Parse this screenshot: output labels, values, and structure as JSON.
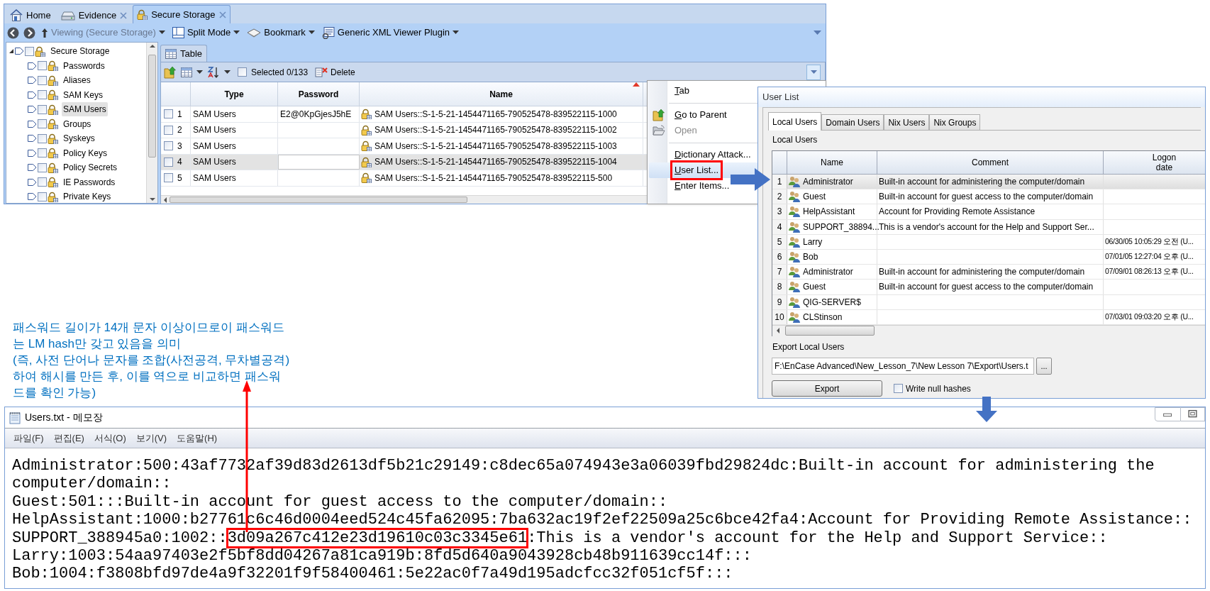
{
  "encase": {
    "tabs": [
      {
        "label": "Home",
        "closable": false,
        "selected": false
      },
      {
        "label": "Evidence",
        "closable": true,
        "selected": false
      },
      {
        "label": "Secure Storage",
        "closable": true,
        "selected": true
      }
    ],
    "toolbar": [
      {
        "label": "Viewing (Secure Storage)",
        "disabled": true
      },
      {
        "label": "Split Mode",
        "disabled": false
      },
      {
        "label": "Bookmark",
        "disabled": false
      },
      {
        "label": "Generic XML Viewer Plugin",
        "disabled": false
      }
    ],
    "tree": {
      "label": "Secure Storage",
      "expanded": true,
      "selected": false,
      "checked": false,
      "children": [
        {
          "label": "Passwords",
          "selected": false,
          "checked": false
        },
        {
          "label": "Aliases",
          "selected": false,
          "checked": false
        },
        {
          "label": "SAM Keys",
          "selected": false,
          "checked": false
        },
        {
          "label": "SAM Users",
          "selected": true,
          "checked": false
        },
        {
          "label": "Groups",
          "selected": false,
          "checked": false
        },
        {
          "label": "Syskeys",
          "selected": false,
          "checked": false
        },
        {
          "label": "Policy Keys",
          "selected": false,
          "checked": false
        },
        {
          "label": "Policy Secrets",
          "selected": false,
          "checked": false
        },
        {
          "label": "IE Passwords",
          "selected": false,
          "checked": false
        },
        {
          "label": "Private Keys",
          "selected": false,
          "checked": false
        }
      ]
    },
    "panel_tab": "Table",
    "table_toolbar": {
      "selection": {
        "label": "Selected 0/133",
        "checked": false
      },
      "delete": "Delete"
    },
    "table": {
      "columns": [
        {
          "label": "Type",
          "sorted": false
        },
        {
          "label": "Password",
          "sorted": false
        },
        {
          "label": "Name",
          "sorted": true
        }
      ],
      "rows": [
        {
          "number": "1",
          "checked": false,
          "selected": false,
          "type": "SAM Users",
          "password": "E2@0KpGjesJ5hE",
          "name": "SAM Users::S-1-5-21-1454471165-790525478-839522115-1000"
        },
        {
          "number": "2",
          "checked": false,
          "selected": false,
          "type": "SAM Users",
          "name": "SAM Users::S-1-5-21-1454471165-790525478-839522115-1002"
        },
        {
          "number": "3",
          "checked": false,
          "selected": false,
          "type": "SAM Users",
          "name": "SAM Users::S-1-5-21-1454471165-790525478-839522115-1003"
        },
        {
          "number": "4",
          "checked": false,
          "selected": true,
          "type": "SAM Users",
          "name": "SAM Users::S-1-5-21-1454471165-790525478-839522115-1004"
        },
        {
          "number": "5",
          "checked": false,
          "selected": false,
          "type": "SAM Users",
          "name": "SAM Users::S-1-5-21-1454471165-790525478-839522115-500"
        }
      ]
    }
  },
  "context_menu": {
    "items": [
      {
        "kind": "item",
        "label": "Tab",
        "mnemonic": true,
        "disabled": false,
        "selected": false
      },
      {
        "kind": "separator"
      },
      {
        "kind": "item",
        "label": "Go to Parent",
        "mnemonic": true,
        "disabled": false,
        "selected": false
      },
      {
        "kind": "item",
        "label": "Open",
        "mnemonic": false,
        "disabled": true,
        "selected": false
      },
      {
        "kind": "separator"
      },
      {
        "kind": "item",
        "label": "Dictionary Attack...",
        "mnemonic": true,
        "disabled": false,
        "selected": false
      },
      {
        "kind": "item",
        "label": "User List...",
        "mnemonic": true,
        "disabled": false,
        "selected": true
      },
      {
        "kind": "item",
        "label": "Enter Items...",
        "mnemonic": true,
        "disabled": false,
        "selected": false
      }
    ]
  },
  "user_list": {
    "title": "User List",
    "tabs": [
      {
        "label": "Local Users",
        "selected": true
      },
      {
        "label": "Domain Users",
        "selected": false
      },
      {
        "label": "Nix Users",
        "selected": false
      },
      {
        "label": "Nix Groups",
        "selected": false
      }
    ],
    "section": "Local Users",
    "columns": [
      "Name",
      "Comment",
      "Logon\ndate"
    ],
    "rows": [
      {
        "number": "1",
        "selected": true,
        "name": "Administrator",
        "comment": "Built-in account for administering the computer/domain"
      },
      {
        "number": "2",
        "selected": false,
        "name": "Guest",
        "comment": "Built-in account for guest access to the computer/domain"
      },
      {
        "number": "3",
        "selected": false,
        "name": "HelpAssistant",
        "comment": "Account for Providing Remote Assistance"
      },
      {
        "number": "4",
        "selected": false,
        "name": "SUPPORT_38894...",
        "comment": "This is a vendor's account for the Help and Support Ser..."
      },
      {
        "number": "5",
        "selected": false,
        "name": "Larry",
        "logon_date": "06/30/05 10:05:29 오전 (U..."
      },
      {
        "number": "6",
        "selected": false,
        "name": "Bob",
        "logon_date": "07/01/05 12:27:04 오후 (U..."
      },
      {
        "number": "7",
        "selected": false,
        "name": "Administrator",
        "comment": "Built-in account for administering the computer/domain",
        "logon_date": "07/09/01 08:26:13 오후 (U..."
      },
      {
        "number": "8",
        "selected": false,
        "name": "Guest",
        "comment": "Built-in account for guest access to the computer/domain"
      },
      {
        "number": "9",
        "selected": false,
        "name": "QIG-SERVER$"
      },
      {
        "number": "10",
        "selected": false,
        "name": "CLStinson",
        "logon_date": "07/03/01 09:03:20 오후 (U..."
      }
    ],
    "export_label": "Export Local Users",
    "path": "F:\\EnCase Advanced\\New_Lesson_7\\New Lesson 7\\Export\\Users.t",
    "browse": "...",
    "export_button": "Export",
    "write_null_hashes": {
      "label": "Write null hashes",
      "checked": false
    }
  },
  "annotation": "패스워드 길이가 14개 문자 이상이므로이 패스워드\n는 LM hash만 갖고 있음을 의미\n(즉, 사전 단어나 문자를 조합(사전공격, 무차별공격)\n하여 해시를 만든 후, 이를 역으로 비교하면 패스워\n드를 확인 가능)",
  "notepad": {
    "title": "Users.txt - 메모장",
    "menu": [
      "파일(F)",
      "편집(E)",
      "서식(O)",
      "보기(V)",
      "도움말(H)"
    ],
    "lines": [
      {
        "segments": [
          {
            "text": "Administrator:500:43af7732af39d83d2613df5b21c29149:c8dec65a074943e3a06039fbd29824dc:Built-in account for administering the",
            "boxed": false
          }
        ]
      },
      {
        "segments": [
          {
            "text": "computer/domain::",
            "boxed": false
          }
        ]
      },
      {
        "segments": [
          {
            "text": "Guest:501:::Built-in account for guest access to the computer/domain::",
            "boxed": false
          }
        ]
      },
      {
        "segments": [
          {
            "text": "HelpAssistant:1000:b27761c6c46d0004eed524c45fa62095:7ba632ac19f2ef22509a25c6bce42fa4:Account for Providing Remote Assistance::",
            "boxed": false
          }
        ]
      },
      {
        "segments": [
          {
            "text": "SUPPORT_388945a0:1002::",
            "boxed": false
          },
          {
            "text": "3d09a267c412e23d19610c03c3345e61",
            "boxed": true
          },
          {
            "text": ":This is a vendor's account for the Help and Support Service::",
            "boxed": false
          }
        ]
      },
      {
        "segments": [
          {
            "text": "Larry:1003:54aa97403e2f5bf8dd04267a81ca919b:8fd5d640a9043928cb48b911639cc14f:::",
            "boxed": false
          }
        ]
      },
      {
        "segments": [
          {
            "text": "Bob:1004:f3808bfd97de4a9f32201f9f58400461:5e22ac0f7a49d195adcfcc32f051cf5f:::",
            "boxed": false
          }
        ]
      }
    ]
  }
}
